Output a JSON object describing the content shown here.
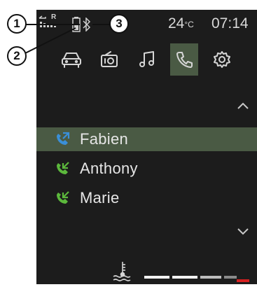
{
  "callouts": [
    "1",
    "2",
    "3"
  ],
  "status": {
    "signal_letter": "R",
    "temperature_value": "24",
    "temperature_unit": "°C",
    "time": "07:14"
  },
  "tabs": [
    {
      "id": "vehicle",
      "icon": "car-icon",
      "active": false
    },
    {
      "id": "radio",
      "icon": "radio-icon",
      "active": false
    },
    {
      "id": "media",
      "icon": "music-note-icon",
      "active": false
    },
    {
      "id": "phone",
      "icon": "phone-icon",
      "active": true
    },
    {
      "id": "settings",
      "icon": "gear-icon",
      "active": false
    }
  ],
  "call_log": [
    {
      "name": "Fabien",
      "type": "missed",
      "icon": "missed-call-icon",
      "color": "#3a8fd8",
      "selected": true
    },
    {
      "name": "Anthony",
      "type": "received",
      "icon": "incoming-call-icon",
      "color": "#5cb83c",
      "selected": false
    },
    {
      "name": "Marie",
      "type": "received",
      "icon": "incoming-call-icon",
      "color": "#5cb83c",
      "selected": false
    }
  ],
  "coolant_gauge": {
    "icon": "coolant-temperature-icon",
    "segments": [
      "#f2f2f2",
      "#f2f2f2",
      "#f2f2f2",
      "#bdbdbd",
      "#8a8a8a",
      "#d62020"
    ]
  },
  "colors": {
    "accent": "#4a5a44",
    "screen_bg": "#1c1c1c"
  }
}
